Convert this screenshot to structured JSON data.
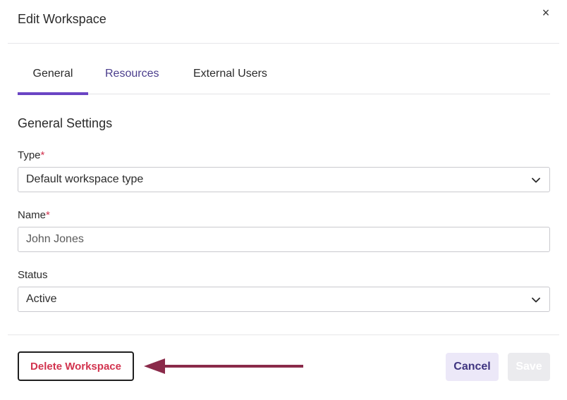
{
  "modal": {
    "title": "Edit Workspace",
    "close_label": "×"
  },
  "tabs": [
    {
      "label": "General",
      "active": true
    },
    {
      "label": "Resources",
      "active": false
    },
    {
      "label": "External Users",
      "active": false
    }
  ],
  "form": {
    "section_title": "General Settings",
    "type": {
      "label": "Type",
      "required_mark": "*",
      "value": "Default workspace type"
    },
    "name": {
      "label": "Name",
      "required_mark": "*",
      "value": "John Jones"
    },
    "status": {
      "label": "Status",
      "value": "Active"
    }
  },
  "footer": {
    "delete_label": "Delete Workspace",
    "cancel_label": "Cancel",
    "save_label": "Save"
  },
  "icons": {
    "close": "close-icon",
    "select_chevron": "chevron-down-icon",
    "annotation": "arrow-left-icon"
  },
  "colors": {
    "accent": "#6a45c4",
    "danger": "#d2344f",
    "arrow": "#8a2a4a",
    "cancel_bg": "#ece8f8",
    "cancel_text": "#3f3580",
    "save_disabled_bg": "#ebebee"
  }
}
